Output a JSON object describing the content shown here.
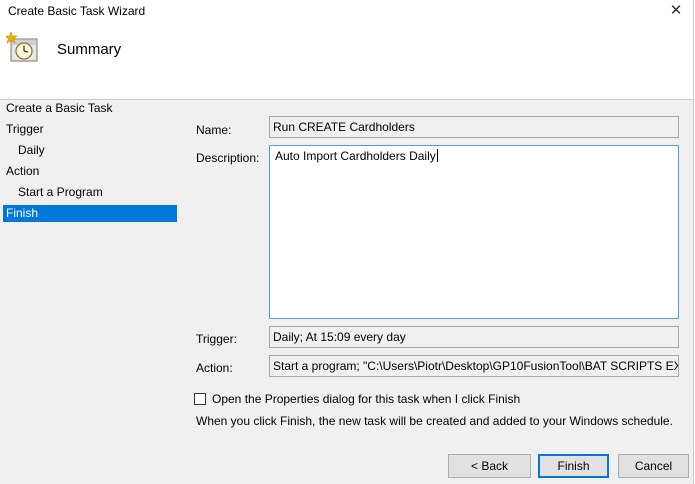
{
  "window": {
    "title": "Create Basic Task Wizard"
  },
  "header": {
    "title": "Summary",
    "icon": "task-scheduler-clock-icon"
  },
  "nav": {
    "items": [
      {
        "label": "Create a Basic Task"
      },
      {
        "label": "Trigger"
      },
      {
        "label": "Daily"
      },
      {
        "label": "Action"
      },
      {
        "label": "Start a Program"
      },
      {
        "label": "Finish"
      }
    ],
    "selected": "Finish"
  },
  "form": {
    "name_label": "Name:",
    "name_value": "Run CREATE Cardholders",
    "description_label": "Description:",
    "description_value": "Auto Import Cardholders Daily",
    "trigger_label": "Trigger:",
    "trigger_value": "Daily; At 15:09 every day",
    "action_label": "Action:",
    "action_value": "Start a program; \"C:\\Users\\Piotr\\Desktop\\GP10FusionTool\\BAT SCRIPTS EXAMPLES\\CREATE Cardholders.bat\""
  },
  "options": {
    "open_properties_label": "Open the Properties dialog for this task when I click Finish",
    "open_properties_checked": false,
    "finish_note": "When you click Finish, the new task will be created and added to your Windows schedule."
  },
  "buttons": {
    "back": "< Back",
    "finish": "Finish",
    "cancel": "Cancel"
  }
}
